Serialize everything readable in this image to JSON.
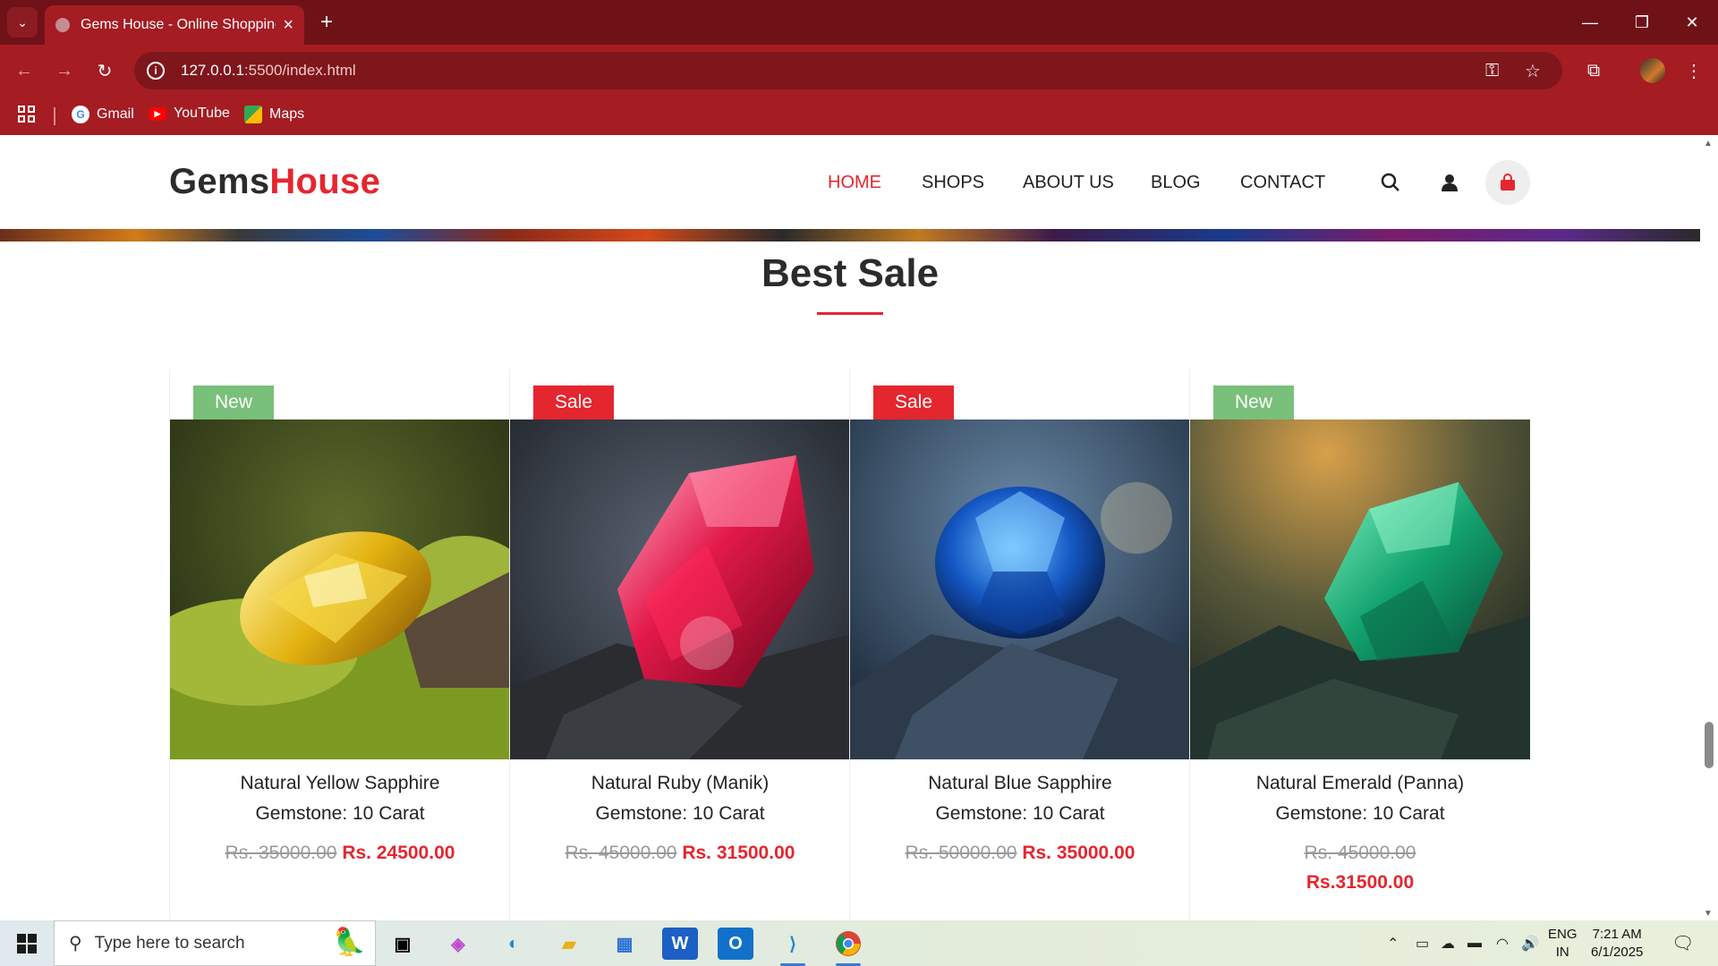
{
  "browser": {
    "tab_title": "Gems House - Online Shopping",
    "new_tab_icon": "+",
    "url_host": "127.0.0.1",
    "url_path": ":5500/index.html",
    "bookmarks": [
      {
        "label": "Gmail"
      },
      {
        "label": "YouTube"
      },
      {
        "label": "Maps"
      }
    ]
  },
  "site": {
    "logo_part1": "Gems",
    "logo_part2": "House",
    "nav": [
      "HOME",
      "SHOPS",
      "ABOUT US",
      "BLOG",
      "CONTACT"
    ],
    "active_nav": "HOME",
    "accent_color": "#e4262f",
    "section_title": "Best Sale"
  },
  "products": [
    {
      "badge": "New",
      "name": "Natural Yellow Sapphire",
      "subtitle": "Gemstone: 10 Carat",
      "old_price": "Rs. 35000.00",
      "new_price": "Rs. 24500.00",
      "image_desc": "yellow-sapphire"
    },
    {
      "badge": "Sale",
      "name": "Natural Ruby (Manik)",
      "subtitle": "Gemstone: 10 Carat",
      "old_price": "Rs. 45000.00",
      "new_price": "Rs. 31500.00",
      "image_desc": "ruby"
    },
    {
      "badge": "Sale",
      "name": "Natural Blue Sapphire",
      "subtitle": "Gemstone: 10 Carat",
      "old_price": "Rs. 50000.00",
      "new_price": "Rs. 35000.00",
      "image_desc": "blue-sapphire"
    },
    {
      "badge": "New",
      "name": "Natural Emerald (Panna)",
      "subtitle": "Gemstone: 10 Carat",
      "old_price": "Rs. 45000.00",
      "new_price": "Rs.31500.00",
      "image_desc": "emerald"
    }
  ],
  "taskbar": {
    "search_placeholder": "Type here to search",
    "lang_line1": "ENG",
    "lang_line2": "IN",
    "time": "7:21 AM",
    "date": "6/1/2025"
  }
}
